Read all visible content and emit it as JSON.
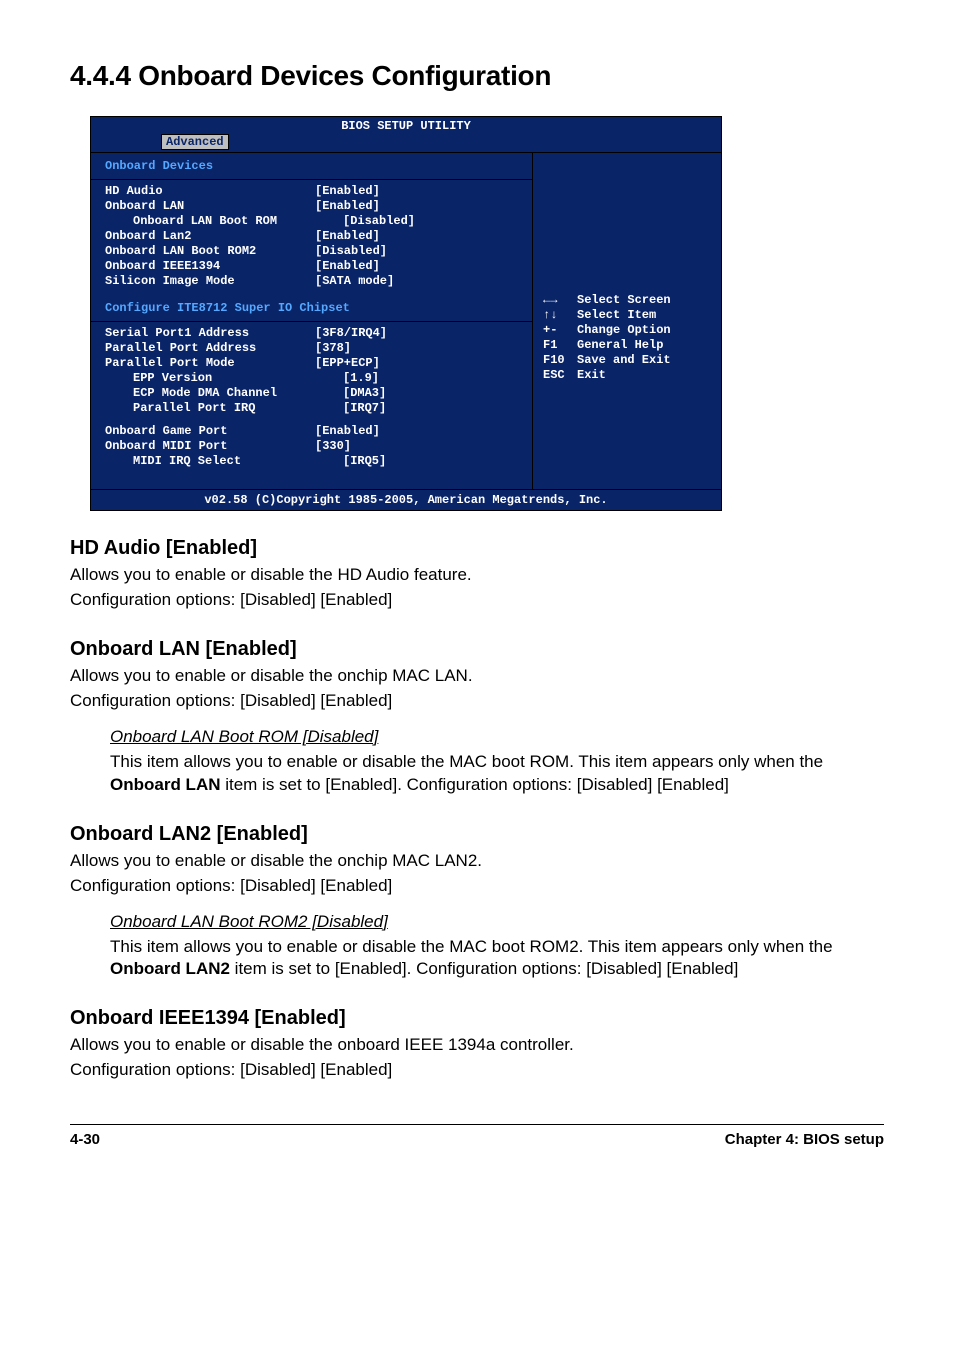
{
  "heading": "4.4.4   Onboard Devices Configuration",
  "bios": {
    "title": "BIOS SETUP UTILITY",
    "tab": "Advanced",
    "panel_heading": "Onboard Devices",
    "group1": [
      {
        "label": "HD Audio",
        "value": "[Enabled]",
        "indent": 0
      },
      {
        "label": "Onboard LAN",
        "value": "[Enabled]",
        "indent": 0
      },
      {
        "label": "Onboard LAN Boot ROM",
        "value": "[Disabled]",
        "indent": 1
      },
      {
        "label": "Onboard Lan2",
        "value": "[Enabled]",
        "indent": 0
      },
      {
        "label": "Onboard LAN Boot ROM2",
        "value": "[Disabled]",
        "indent": 0
      },
      {
        "label": "Onboard IEEE1394",
        "value": "[Enabled]",
        "indent": 0
      },
      {
        "label": "Silicon Image Mode",
        "value": "[SATA mode]",
        "indent": 0
      }
    ],
    "section_label": "Configure ITE8712 Super IO Chipset",
    "group2": [
      {
        "label": "Serial Port1 Address",
        "value": "[3F8/IRQ4]",
        "indent": 0
      },
      {
        "label": "Parallel Port Address",
        "value": "[378]",
        "indent": 0
      },
      {
        "label": "Parallel Port Mode",
        "value": "[EPP+ECP]",
        "indent": 0
      },
      {
        "label": "EPP Version",
        "value": "[1.9]",
        "indent": 1
      },
      {
        "label": "ECP Mode DMA Channel",
        "value": "[DMA3]",
        "indent": 1
      },
      {
        "label": "Parallel Port IRQ",
        "value": "[IRQ7]",
        "indent": 1
      }
    ],
    "group3": [
      {
        "label": "Onboard Game Port",
        "value": "[Enabled]",
        "indent": 0
      },
      {
        "label": "Onboard MIDI Port",
        "value": "[330]",
        "indent": 0
      },
      {
        "label": "MIDI IRQ Select",
        "value": "[IRQ5]",
        "indent": 1
      }
    ],
    "legend": [
      {
        "key": "←→",
        "desc": "Select Screen"
      },
      {
        "key": "↑↓",
        "desc": "Select Item"
      },
      {
        "key": "+-",
        "desc": "Change Option"
      },
      {
        "key": "F1",
        "desc": "General Help"
      },
      {
        "key": "F10",
        "desc": "Save and Exit"
      },
      {
        "key": "ESC",
        "desc": "Exit"
      }
    ],
    "footer": "v02.58 (C)Copyright 1985-2005, American Megatrends, Inc."
  },
  "sections": {
    "hd_audio": {
      "title": "HD Audio [Enabled]",
      "line1": "Allows you to enable or disable the HD Audio feature.",
      "line2": "Configuration options: [Disabled] [Enabled]"
    },
    "onboard_lan": {
      "title": "Onboard LAN [Enabled]",
      "line1": "Allows you to enable or disable the onchip MAC LAN.",
      "line2": "Configuration options: [Disabled] [Enabled]",
      "sub_title": "Onboard LAN Boot ROM [Disabled]",
      "sub_text_a": "This item allows you to enable or disable the MAC boot ROM. This item appears only when the ",
      "sub_bold": "Onboard LAN",
      "sub_text_b": " item is set to [Enabled]. Configuration options: [Disabled] [Enabled]"
    },
    "onboard_lan2": {
      "title": "Onboard LAN2 [Enabled]",
      "line1": "Allows you to enable or disable the onchip MAC LAN2.",
      "line2": "Configuration options: [Disabled] [Enabled]",
      "sub_title": "Onboard LAN Boot ROM2 [Disabled]",
      "sub_text_a": "This item allows you to enable or disable the MAC boot ROM2. This item appears only when the ",
      "sub_bold": "Onboard LAN2",
      "sub_text_b": " item is set to [Enabled]. Configuration options: [Disabled] [Enabled]"
    },
    "onboard_1394": {
      "title": "Onboard IEEE1394 [Enabled]",
      "line1": "Allows you to enable or disable the onboard IEEE 1394a controller.",
      "line2": "Configuration options: [Disabled] [Enabled]"
    }
  },
  "footer": {
    "left": "4-30",
    "right": "Chapter 4: BIOS setup"
  }
}
